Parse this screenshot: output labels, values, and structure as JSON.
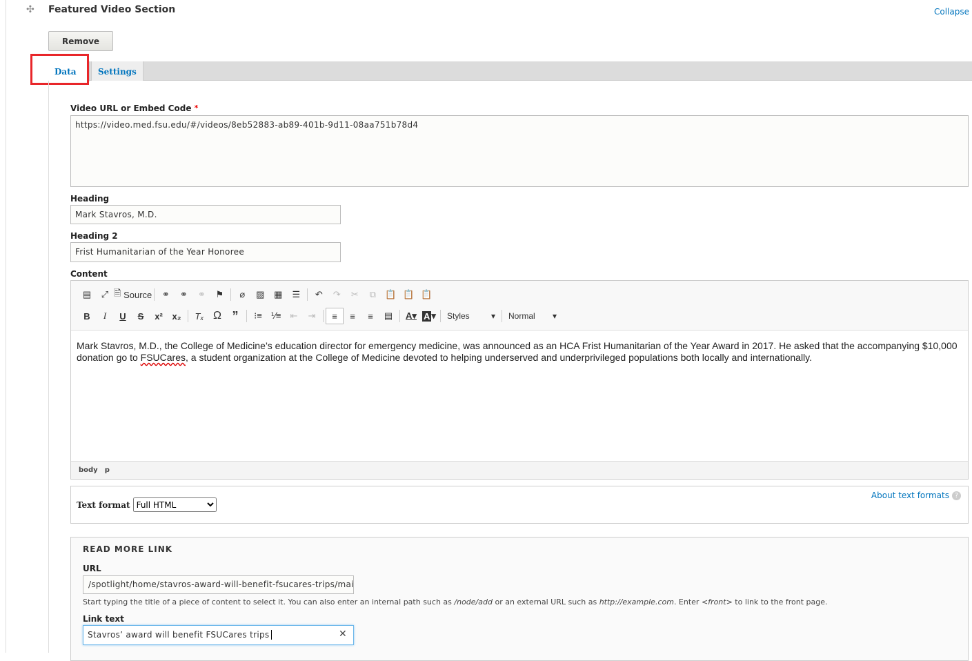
{
  "section": {
    "title": "Featured Video Section",
    "collapse_label": "Collapse",
    "remove_label": "Remove",
    "drag_icon": "move-icon"
  },
  "tabs": [
    {
      "label": "Data",
      "active": true
    },
    {
      "label": "Settings",
      "active": false
    }
  ],
  "highlight_color": "#e8262a",
  "fields": {
    "video": {
      "label": "Video URL or Embed Code",
      "required": "*",
      "value": "https://video.med.fsu.edu/#/videos/8eb52883-ab89-401b-9d11-08aa751b78d4"
    },
    "heading": {
      "label": "Heading",
      "value": "Mark Stavros, M.D."
    },
    "heading2": {
      "label": "Heading 2",
      "value": "Frist Humanitarian of the Year Honoree"
    },
    "content": {
      "label": "Content",
      "source_label": "Source",
      "styles_label": "Styles",
      "format_label": "Normal",
      "body_part1": "Mark Stavros, M.D., the College of Medicine’s education director for emergency medicine, was announced as an HCA Frist Humanitarian of the Year Award in 2017. He asked that the accompanying $10,000 donation go to ",
      "body_link": "FSUCares",
      "body_part2": ", a student organization at the College of Medicine devoted to helping underserved and underprivileged populations both locally and internationally.",
      "path": [
        "body",
        "p"
      ]
    },
    "text_format": {
      "label": "Text format",
      "value": "Full HTML",
      "about": "About text formats"
    }
  },
  "read_more": {
    "legend": "READ MORE LINK",
    "url_label": "URL",
    "url_value": "/spotlight/home/stavros-award-will-benefit-fsucares-trips/main",
    "help_1": "Start typing the title of a piece of content to select it. You can also enter an internal path such as ",
    "help_em1": "/node/add",
    "help_2": " or an external URL such as ",
    "help_em2": "http://example.com",
    "help_3": ". Enter ",
    "help_em3": "<front>",
    "help_4": " to link to the front page.",
    "link_text_label": "Link text",
    "link_text_value": "Stavros’ award will benefit FSUCares trips"
  }
}
